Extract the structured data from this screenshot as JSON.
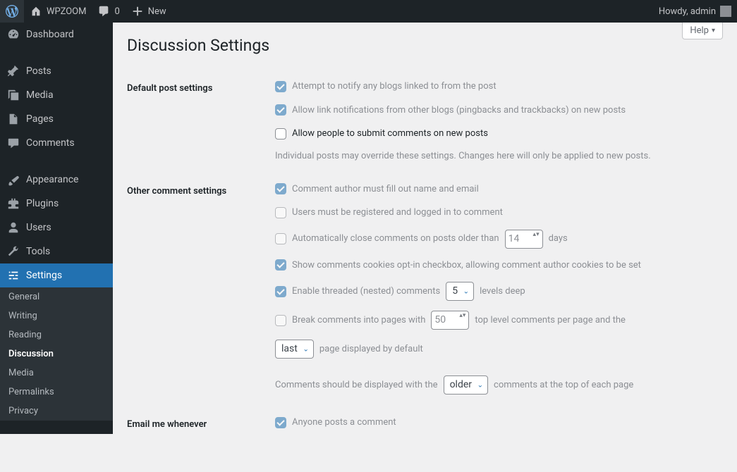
{
  "adminbar": {
    "site_name": "WPZOOM",
    "comments_count": "0",
    "new_label": "New",
    "howdy_label": "Howdy, admin"
  },
  "menu": {
    "dashboard": "Dashboard",
    "posts": "Posts",
    "media": "Media",
    "pages": "Pages",
    "comments": "Comments",
    "appearance": "Appearance",
    "plugins": "Plugins",
    "users": "Users",
    "tools": "Tools",
    "settings": "Settings"
  },
  "submenu": {
    "general": "General",
    "writing": "Writing",
    "reading": "Reading",
    "discussion": "Discussion",
    "media": "Media",
    "permalinks": "Permalinks",
    "privacy": "Privacy"
  },
  "page": {
    "help_label": "Help",
    "title": "Discussion Settings"
  },
  "sections": {
    "default_post": {
      "heading": "Default post settings",
      "opt_notify": "Attempt to notify any blogs linked to from the post",
      "opt_pingback": "Allow link notifications from other blogs (pingbacks and trackbacks) on new posts",
      "opt_comments": "Allow people to submit comments on new posts",
      "note": "Individual posts may override these settings. Changes here will only be applied to new posts."
    },
    "other": {
      "heading": "Other comment settings",
      "opt_name_email": "Comment author must fill out name and email",
      "opt_registered": "Users must be registered and logged in to comment",
      "opt_autoclose_pre": "Automatically close comments on posts older than",
      "opt_autoclose_days_value": "14",
      "opt_autoclose_post": "days",
      "opt_cookies": "Show comments cookies opt-in checkbox, allowing comment author cookies to be set",
      "opt_threaded_pre": "Enable threaded (nested) comments",
      "opt_threaded_levels_value": "5",
      "opt_threaded_post": "levels deep",
      "opt_paginate_pre": "Break comments into pages with",
      "opt_paginate_perpage_value": "50",
      "opt_paginate_mid": "top level comments per page and the",
      "opt_paginate_page_value": "last",
      "opt_paginate_post": "page displayed by default",
      "opt_order_pre": "Comments should be displayed with the",
      "opt_order_value": "older",
      "opt_order_post": "comments at the top of each page"
    },
    "email": {
      "heading": "Email me whenever",
      "opt_anyone": "Anyone posts a comment"
    }
  }
}
